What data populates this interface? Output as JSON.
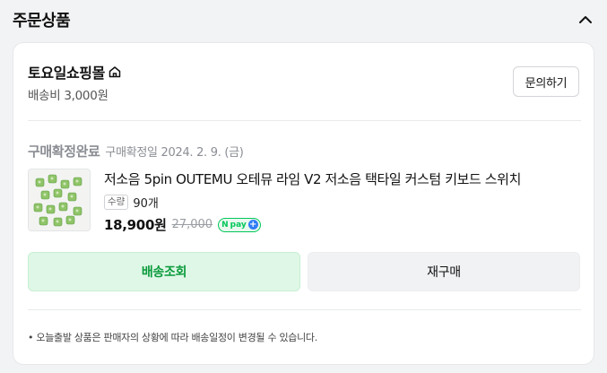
{
  "section": {
    "title": "주문상품"
  },
  "shop": {
    "name": "토요일쇼핑몰",
    "shipping_fee": "배송비 3,000원",
    "inquiry_label": "문의하기"
  },
  "order": {
    "status": "구매확정완료",
    "confirm_date": "구매확정일 2024. 2. 9. (금)"
  },
  "product": {
    "name": "저소음 5pin OUTEMU 오테뮤 라임 V2 저소음 택타일 커스텀 키보드 스위치",
    "qty_label": "수량",
    "qty_value": "90개",
    "price": "18,900원",
    "original_price": "27,000",
    "npay_label": "pay"
  },
  "actions": {
    "track_label": "배송조회",
    "reorder_label": "재구매"
  },
  "notice": "오늘출발 상품은 판매자의 상황에 따라 배송일정이 변경될 수 있습니다."
}
